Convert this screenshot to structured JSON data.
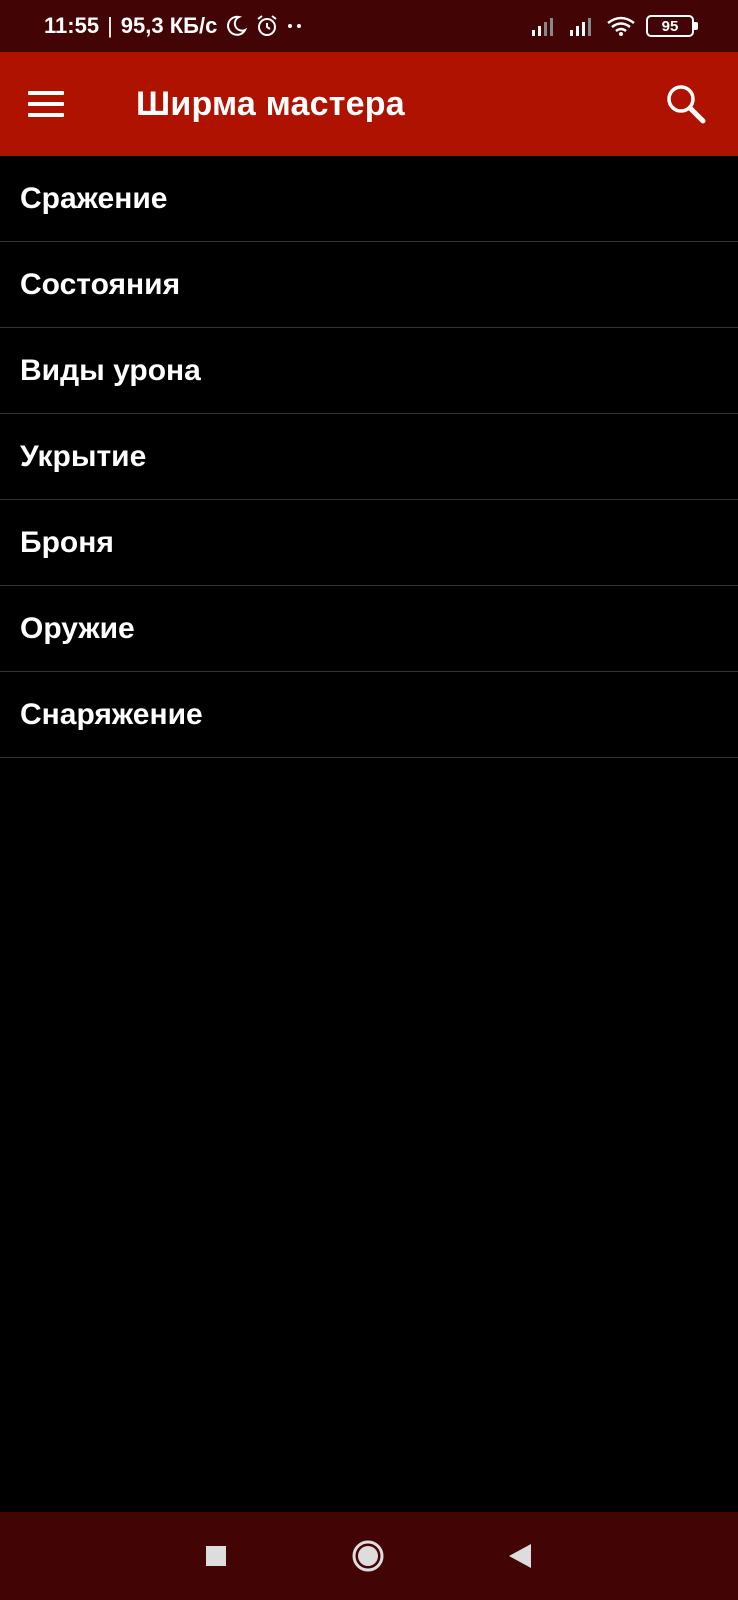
{
  "status_bar": {
    "time": "11:55",
    "separator": "|",
    "network_speed": "95,3 КБ/с",
    "battery_level": "95",
    "icons": [
      "moon-icon",
      "alarm-icon",
      "dots-icon",
      "signal-icon",
      "signal-icon",
      "wifi-icon",
      "battery-icon"
    ]
  },
  "app_bar": {
    "title": "Ширма мастера",
    "menu_icon": "hamburger-menu-icon",
    "search_icon": "search-icon",
    "color": "#b01200"
  },
  "list": {
    "items": [
      {
        "label": "Сражение"
      },
      {
        "label": "Состояния"
      },
      {
        "label": "Виды урона"
      },
      {
        "label": "Укрытие"
      },
      {
        "label": "Броня"
      },
      {
        "label": "Оружие"
      },
      {
        "label": "Снаряжение"
      }
    ]
  },
  "nav_bar": {
    "icons": [
      "recents-square-icon",
      "home-circle-icon",
      "back-triangle-icon"
    ],
    "color": "#420404"
  }
}
